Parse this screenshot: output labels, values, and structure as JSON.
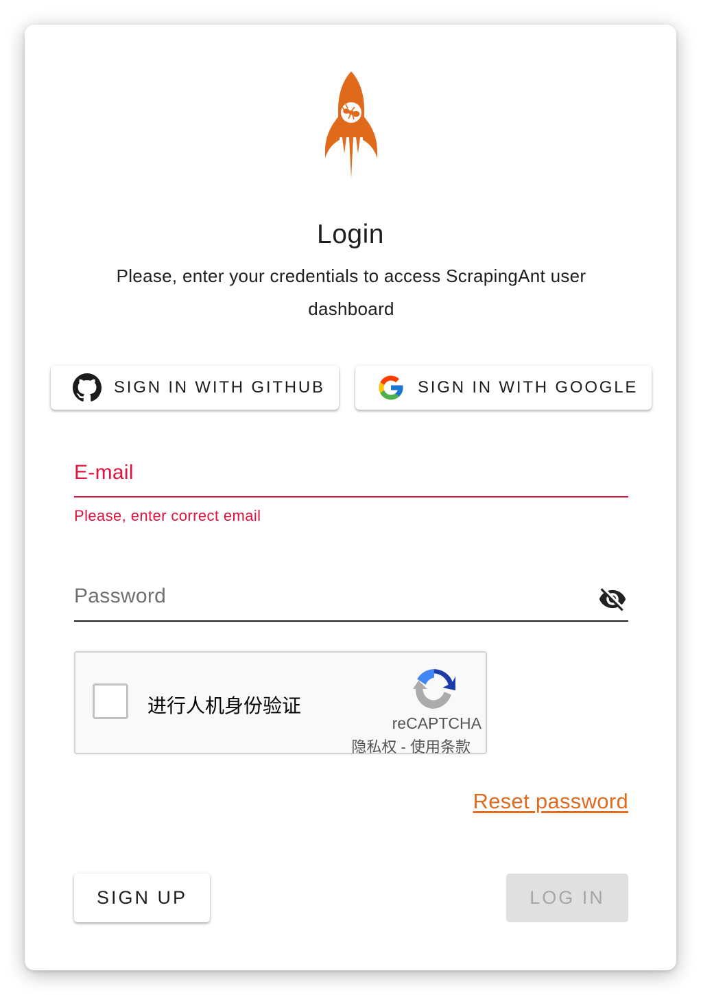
{
  "logo": {
    "icon": "rocket-ant-icon",
    "color": "#e0691c"
  },
  "header": {
    "title": "Login",
    "subtitle": "Please, enter your credentials to access ScrapingAnt user dashboard"
  },
  "oauth": {
    "github_label": "SIGN IN WITH GITHUB",
    "github_icon": "github-icon",
    "google_label": "SIGN IN WITH GOOGLE",
    "google_icon": "google-icon"
  },
  "email": {
    "label": "E-mail",
    "value": "",
    "error": "Please, enter correct email",
    "state": "error",
    "error_color": "#e0123e"
  },
  "password": {
    "label": "Password",
    "value": "",
    "visibility_icon": "eye-off-icon"
  },
  "recaptcha": {
    "checkbox_label": "进行人机身份验证",
    "checked": false,
    "brand": "reCAPTCHA",
    "privacy_link": "隐私权",
    "separator": " - ",
    "terms_link": "使用条款"
  },
  "links": {
    "reset_password": "Reset password",
    "accent": "#de6b1f"
  },
  "actions": {
    "signup_label": "SIGN UP",
    "login_label": "LOG IN",
    "login_disabled": true
  }
}
